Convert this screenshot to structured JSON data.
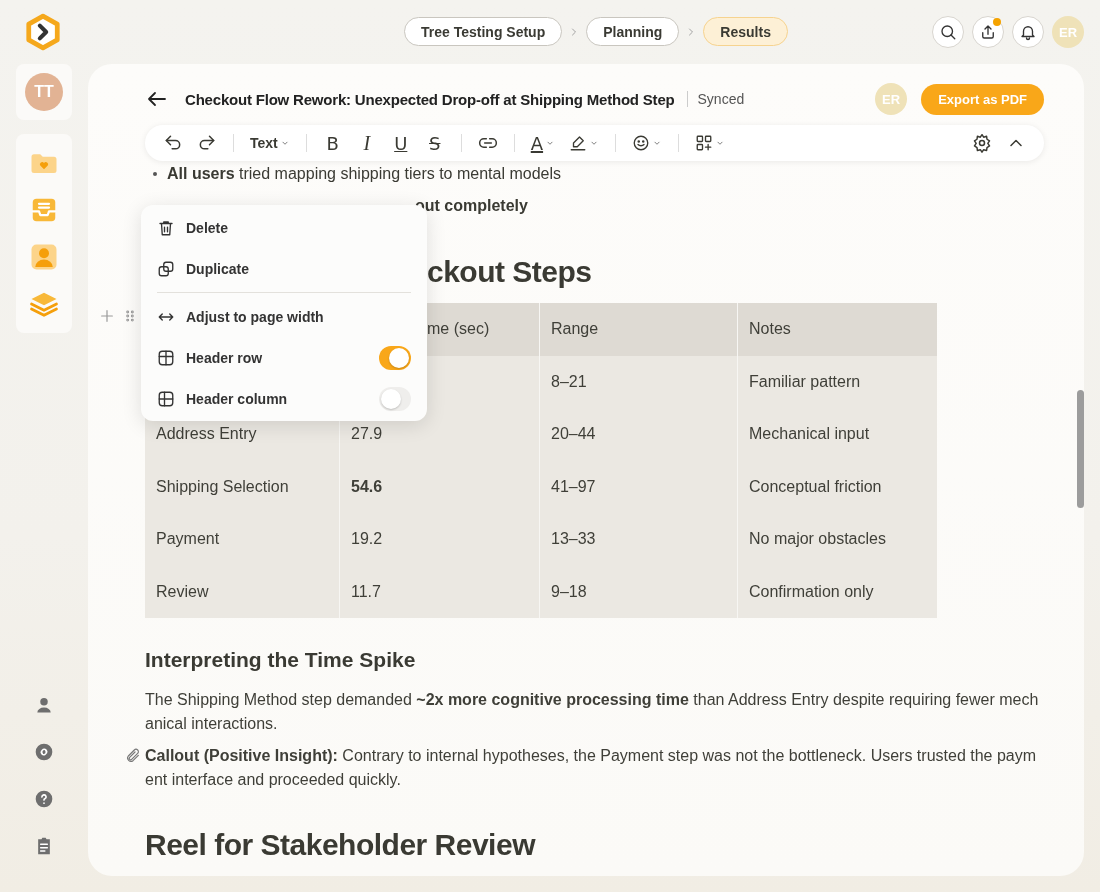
{
  "breadcrumb": [
    {
      "label": "Tree Testing Setup",
      "selected": false
    },
    {
      "label": "Planning",
      "selected": false
    },
    {
      "label": "Results",
      "selected": true
    }
  ],
  "top_actions": {
    "upload_has_badge": true,
    "avatar": "ER"
  },
  "sidebar": {
    "avatar": "TT"
  },
  "document": {
    "title": "Checkout Flow Rework: Unexpected Drop-off at Shipping Method Step",
    "sync_status": "Synced",
    "collaborator": "ER",
    "export_button": "Export as PDF"
  },
  "toolbar": {
    "style_dropdown": "Text",
    "format_buttons": [
      {
        "glyph": "B",
        "kind": "bold"
      },
      {
        "glyph": "I",
        "kind": "italic"
      },
      {
        "glyph": "U",
        "kind": "underline"
      },
      {
        "glyph": "S",
        "kind": "strike"
      }
    ],
    "text_color": "A"
  },
  "content": {
    "bullets": [
      {
        "text": "**All users** tried mapping shipping tiers to mental models",
        "bold": false
      },
      {
        "text": "out completely",
        "bold": true
      }
    ],
    "table_heading": "ckout Steps",
    "table": {
      "columns": [
        {
          "label": "me (sec)"
        },
        {
          "label": "Range"
        },
        {
          "label": "Notes"
        }
      ],
      "rows": [
        {
          "range": "8–21",
          "notes": "Familiar pattern"
        },
        {
          "step": "Address Entry",
          "time": "27.9",
          "range": "20–44",
          "notes": "Mechanical input",
          "time_bold": false
        },
        {
          "step": "Shipping Selection",
          "time": "54.6",
          "range": "41–97",
          "notes": "Conceptual friction",
          "time_bold": true
        },
        {
          "step": "Payment",
          "time": "19.2",
          "range": "13–33",
          "notes": "No major obstacles",
          "time_bold": false
        },
        {
          "step": "Review",
          "time": "11.7",
          "range": "9–18",
          "notes": "Confirmation only",
          "time_bold": false
        }
      ]
    },
    "subheading": "Interpreting the Time Spike",
    "paragraph": "The Shipping Method step demanded **~2x more cognitive processing time** than Address Entry despite requiring fewer mechanical interactions.",
    "callout": "**Callout (Positive Insight):** Contrary to internal hypotheses, the Payment step was not the bottleneck. Users trusted the payment interface and proceeded quickly.",
    "section_heading": "Reel for Stakeholder Review"
  },
  "context_menu": {
    "groups": [
      [
        {
          "label": "Delete",
          "kind": "action"
        },
        {
          "label": "Duplicate",
          "kind": "action"
        }
      ],
      [
        {
          "label": "Adjust to page width",
          "kind": "action"
        },
        {
          "label": "Header row",
          "kind": "toggle",
          "on": true
        },
        {
          "label": "Header column",
          "kind": "toggle",
          "on": false
        }
      ]
    ]
  }
}
